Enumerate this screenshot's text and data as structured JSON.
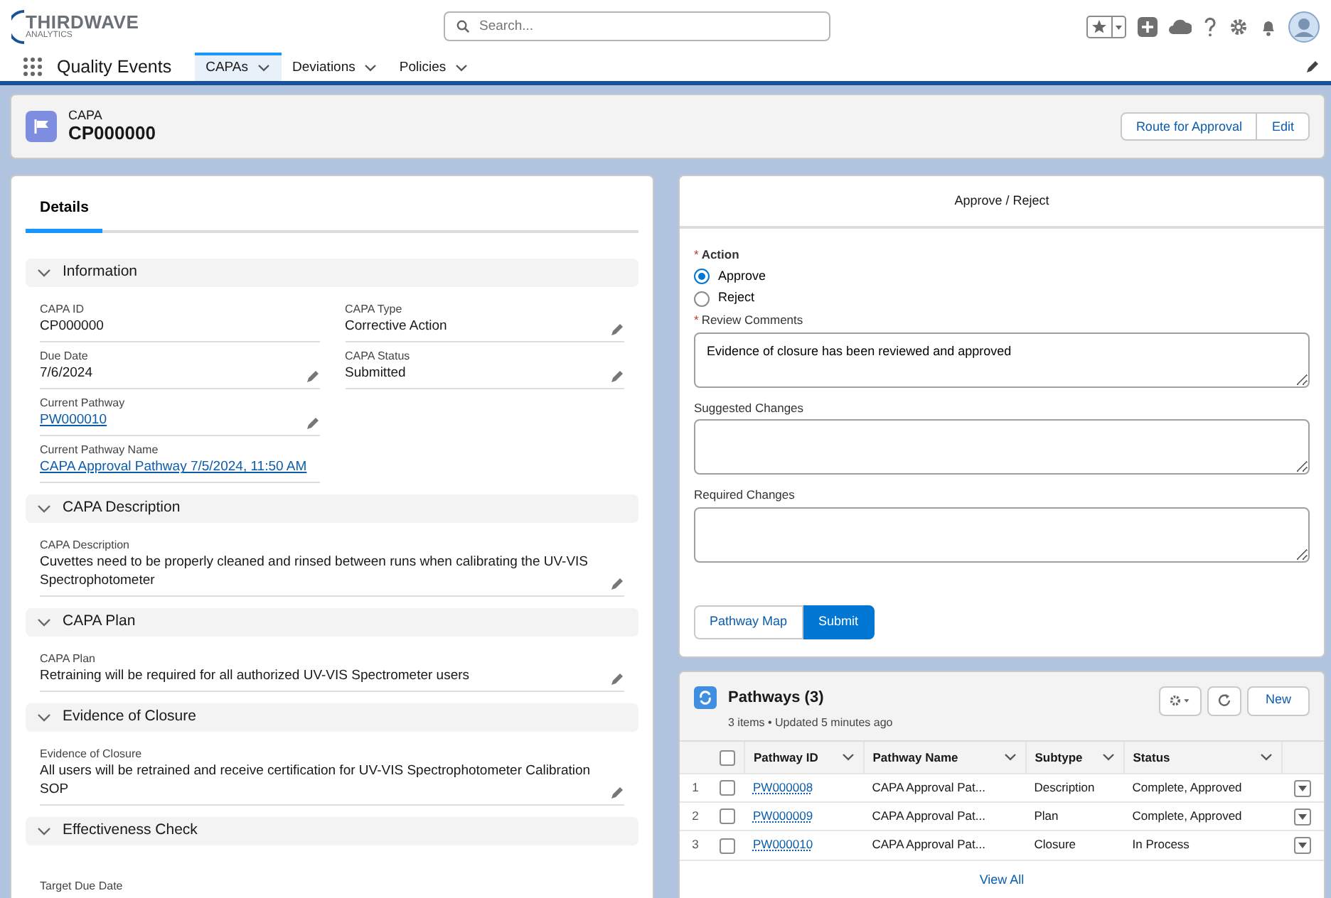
{
  "header": {
    "logo_text": "THIRDWAVE",
    "logo_subtext": "ANALYTICS",
    "search": {
      "placeholder": "Search..."
    }
  },
  "app_nav": {
    "app_name": "Quality Events",
    "tabs": [
      {
        "label": "CAPAs",
        "selected": true
      },
      {
        "label": "Deviations",
        "selected": false
      },
      {
        "label": "Policies",
        "selected": false
      }
    ]
  },
  "record": {
    "object": "CAPA",
    "title": "CP000000",
    "buttons": [
      "Route for Approval",
      "Edit"
    ]
  },
  "details": {
    "tabs": [
      {
        "label": "Details",
        "selected": true
      }
    ],
    "sections": [
      {
        "title": "Information",
        "expanded": true,
        "columns": [
          [
            {
              "label": "CAPA ID",
              "value": "CP000000",
              "kind": "text",
              "editable": false
            },
            {
              "label": "Due Date",
              "value": "7/6/2024",
              "kind": "text",
              "editable": true
            },
            {
              "label": "Current Pathway",
              "value": "PW000010",
              "kind": "link",
              "editable": true
            },
            {
              "label": "Current Pathway Name",
              "value": "CAPA Approval Pathway 7/5/2024, 11:50 AM",
              "kind": "link",
              "editable": false
            }
          ],
          [
            {
              "label": "CAPA Type",
              "value": "Corrective Action",
              "kind": "text",
              "editable": true
            },
            {
              "label": "CAPA Status",
              "value": "Submitted",
              "kind": "text",
              "editable": true
            }
          ]
        ]
      },
      {
        "title": "CAPA Description",
        "expanded": true,
        "columns": [
          [
            {
              "label": "CAPA Description",
              "value": "Cuvettes need to be properly cleaned and rinsed between runs when calibrating the UV-VIS Spectrophotometer",
              "kind": "text",
              "editable": true
            }
          ]
        ]
      },
      {
        "title": "CAPA Plan",
        "expanded": true,
        "columns": [
          [
            {
              "label": "CAPA Plan",
              "value": "Retraining will be required for all authorized UV-VIS Spectrometer users",
              "kind": "text",
              "editable": true
            }
          ]
        ]
      },
      {
        "title": "Evidence of Closure",
        "expanded": true,
        "columns": [
          [
            {
              "label": "Evidence of Closure",
              "value": "All users will be retrained and receive certification for UV-VIS Spectrophotometer Calibration SOP",
              "kind": "text",
              "editable": true
            }
          ]
        ]
      },
      {
        "title": "Effectiveness Check",
        "expanded": true,
        "columns": [
          [
            {
              "label": "Target Due Date",
              "editable": false
            }
          ]
        ]
      }
    ]
  },
  "approval": {
    "title": "Approve / Reject",
    "action": {
      "label": "Action",
      "required_mark": "*",
      "options": [
        {
          "label": "Approve",
          "selected": true
        },
        {
          "label": "Reject",
          "selected": false
        }
      ]
    },
    "fields": [
      {
        "label": "Review Comments",
        "required_mark": "*",
        "value": "Evidence of closure has been reviewed and approved"
      },
      {
        "label": "Suggested Changes"
      },
      {
        "label": "Required Changes"
      }
    ],
    "buttons": [
      {
        "label": "Pathway Map",
        "kind": "neutral"
      },
      {
        "label": "Submit",
        "kind": "brand"
      }
    ]
  },
  "pathways": {
    "title": "Pathways (3)",
    "meta": "3 items • Updated 5 minutes ago",
    "buttons": [
      "New"
    ],
    "select_all_checked": false,
    "columns": [
      "Pathway ID",
      "Pathway Name",
      "Subtype",
      "Status"
    ],
    "rows": [
      {
        "number": "1",
        "checked": false,
        "cells": [
          "PW000008",
          "CAPA Approval Pat...",
          "Description",
          "Complete, Approved"
        ]
      },
      {
        "number": "2",
        "checked": false,
        "cells": [
          "PW000009",
          "CAPA Approval Pat...",
          "Plan",
          "Complete, Approved"
        ]
      },
      {
        "number": "3",
        "checked": false,
        "cells": [
          "PW000010",
          "CAPA Approval Pat...",
          "Closure",
          "In Process"
        ]
      }
    ],
    "footer_link": "View All"
  }
}
